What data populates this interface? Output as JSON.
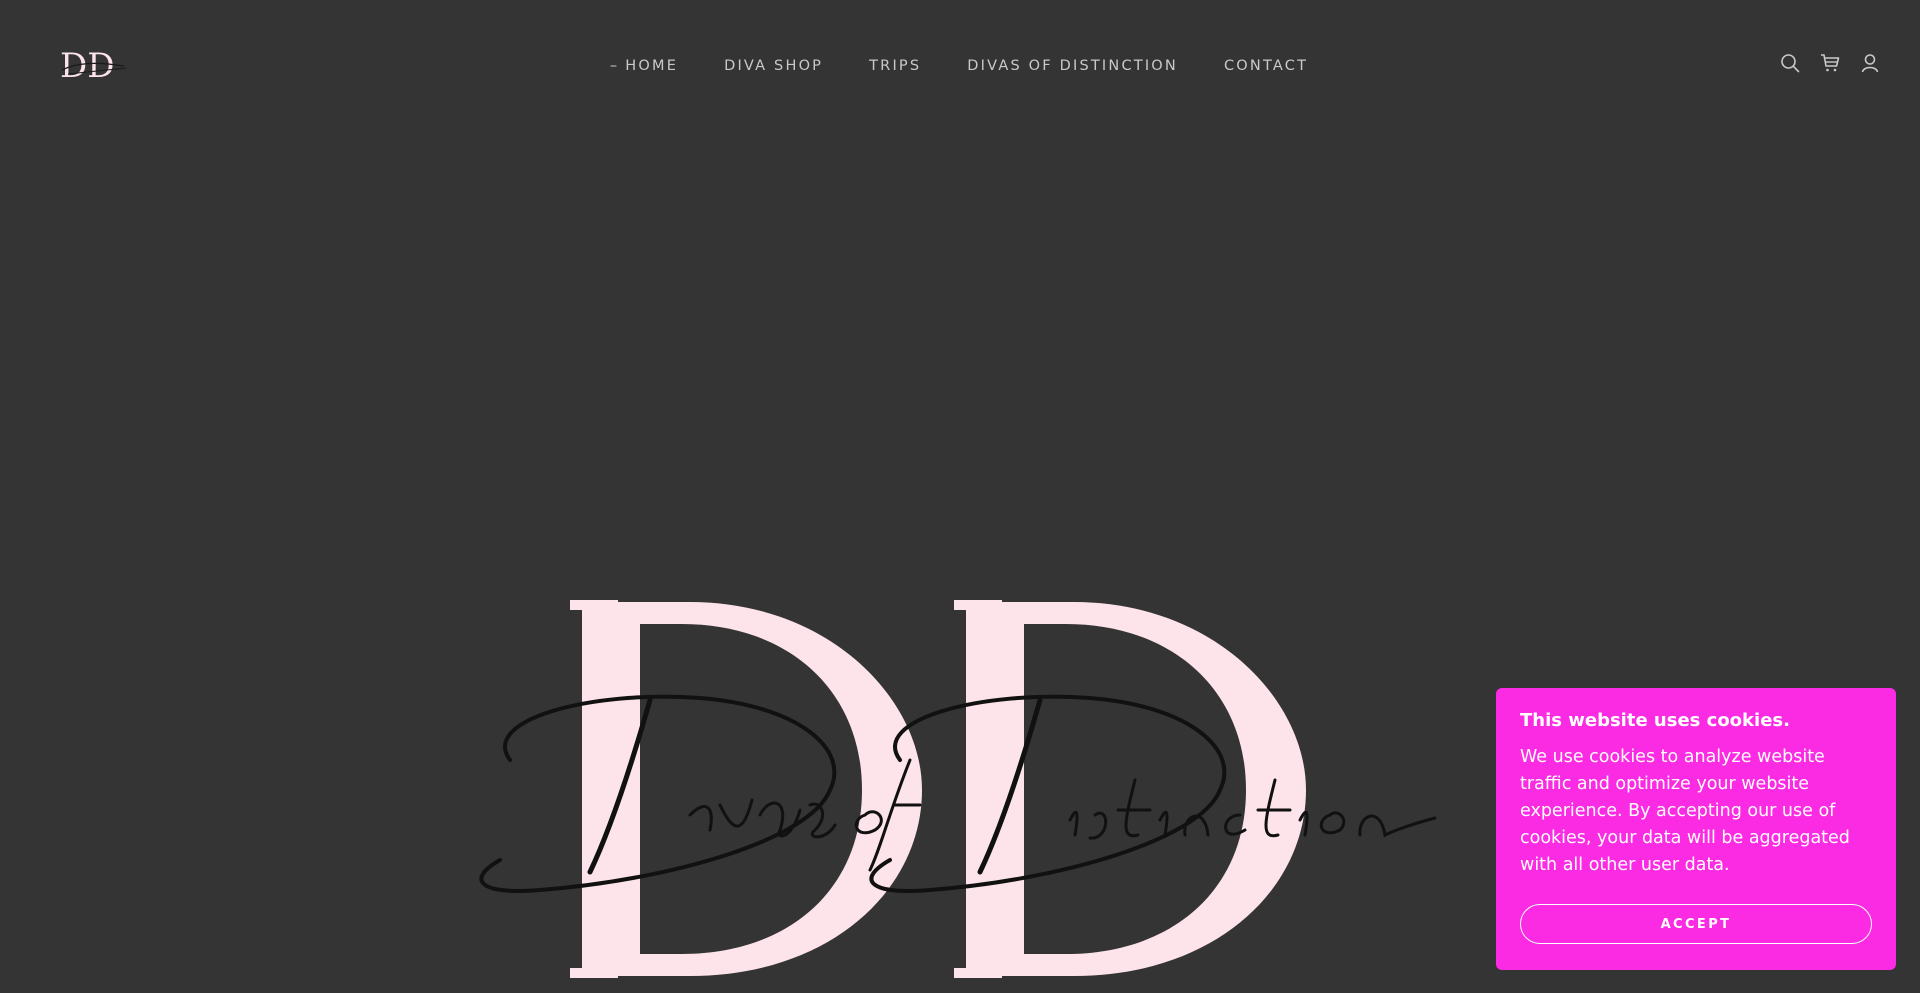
{
  "brand": {
    "logo_text": "DD",
    "tagline": "Divas of Distinction",
    "colors": {
      "background": "#343434",
      "logo_pink": "#fde4ea",
      "accent": "#fb2be4",
      "nav_text": "#c9c9c9"
    }
  },
  "nav": {
    "items": [
      {
        "label": "HOME",
        "active": true
      },
      {
        "label": "DIVA SHOP"
      },
      {
        "label": "TRIPS"
      },
      {
        "label": "DIVAS OF DISTINCTION"
      },
      {
        "label": "CONTACT"
      }
    ],
    "active_marker": "–"
  },
  "header_icons": [
    "search-icon",
    "cart-icon",
    "account-icon"
  ],
  "cookie": {
    "title": "This website uses cookies.",
    "body": "We use cookies to analyze website traffic and optimize your website experience. By accepting our use of cookies, your data will be aggregated with all other user data.",
    "accept_label": "ACCEPT"
  }
}
